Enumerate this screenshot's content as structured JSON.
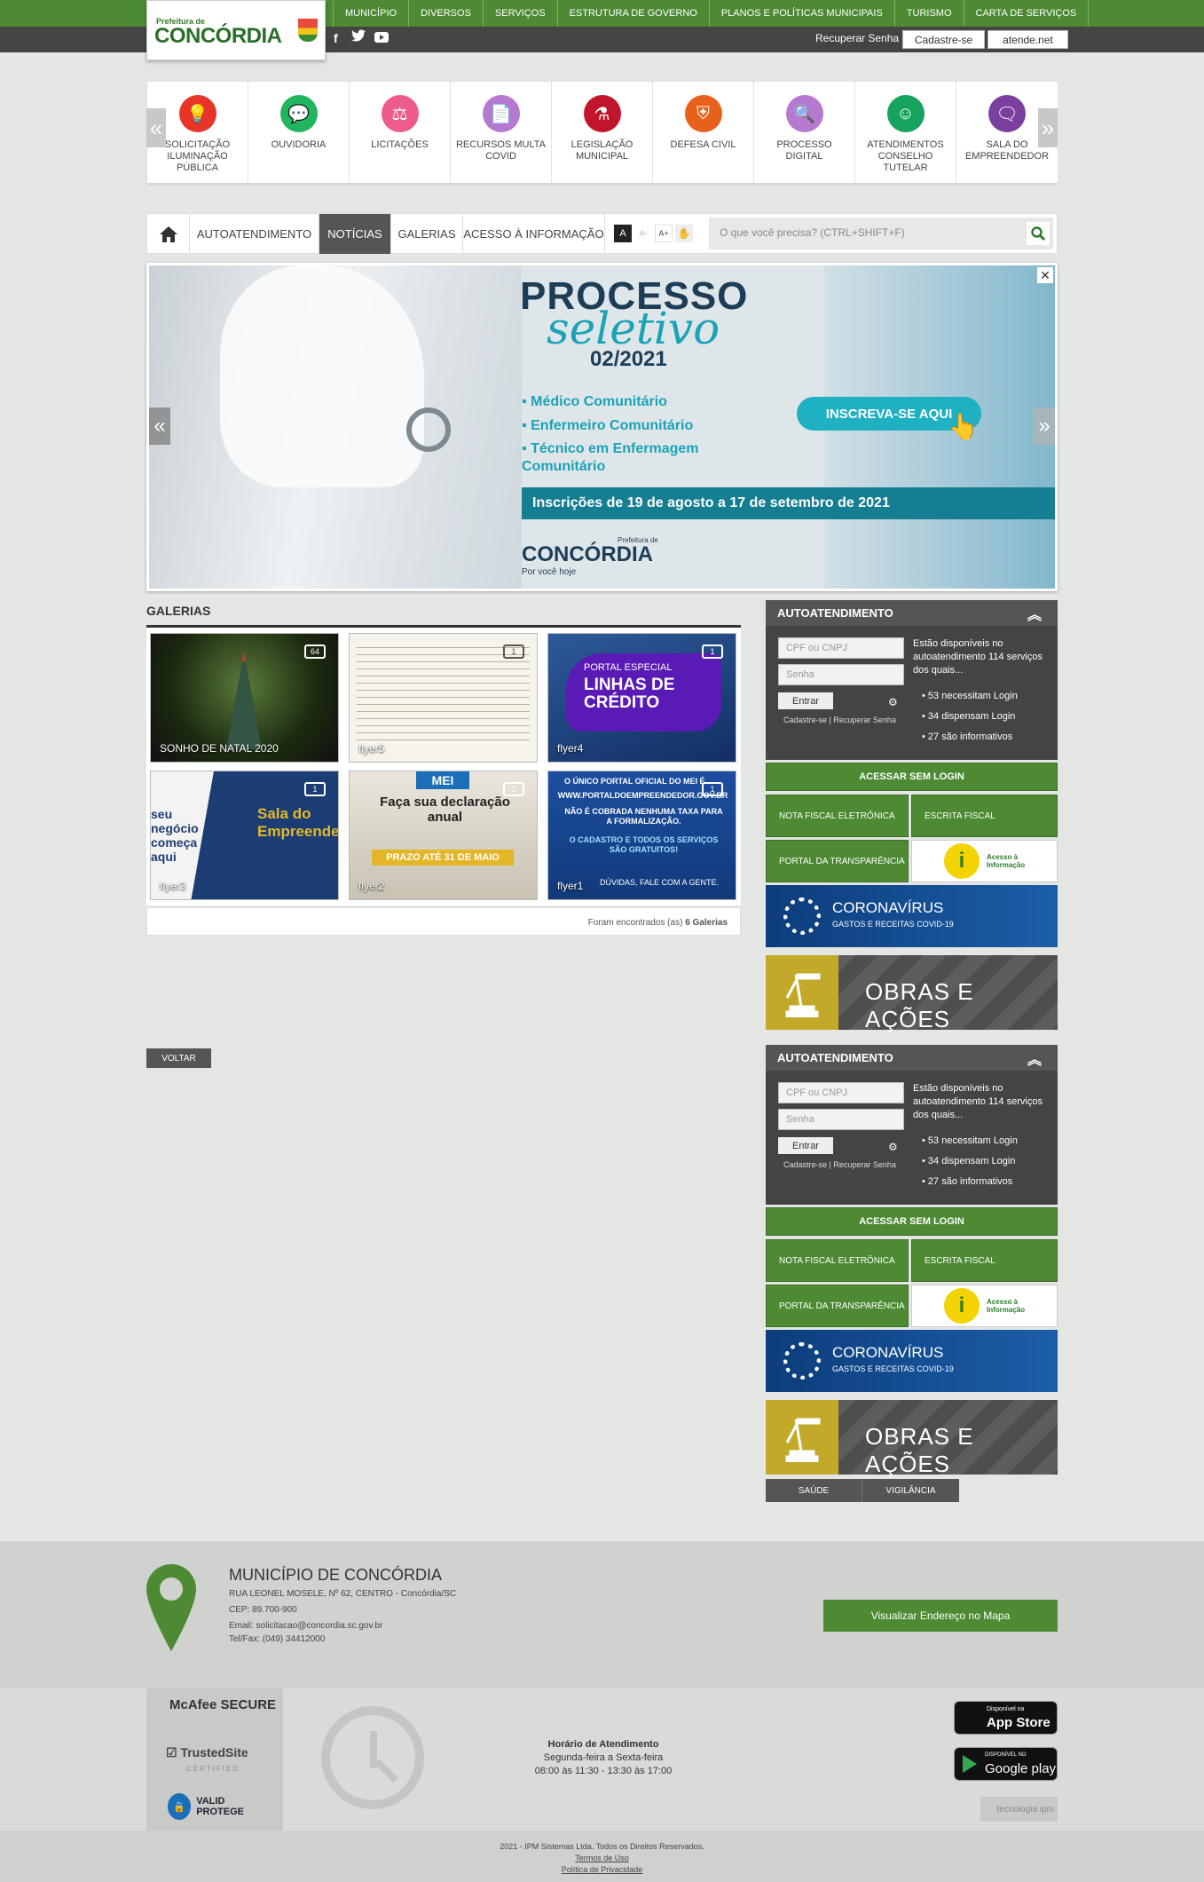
{
  "header": {
    "logo_small": "Prefeitura de",
    "logo_big": "CONCÓRDIA",
    "nav": [
      "MUNICÍPIO",
      "DIVERSOS",
      "SERVIÇOS",
      "ESTRUTURA DE GOVERNO",
      "PLANOS E POLÍTICAS MUNICIPAIS",
      "TURISMO",
      "CARTA DE SERVIÇOS"
    ],
    "recover": "Recuperar Senha",
    "signup": "Cadastre-se",
    "atende": "atende.net"
  },
  "carousel": {
    "items": [
      {
        "label": "SOLICITAÇÃO ILUMINAÇÃO PÚBLICA",
        "icon": "lightbulb-icon",
        "color": "#e8352a"
      },
      {
        "label": "OUVIDORIA",
        "icon": "chat-icon",
        "color": "#22b560"
      },
      {
        "label": "LICITAÇÕES",
        "icon": "auction-icon",
        "color": "#ee5c8c"
      },
      {
        "label": "RECURSOS MULTA COVID",
        "icon": "document-icon",
        "color": "#b57ad0"
      },
      {
        "label": "LEGISLAÇÃO MUNICIPAL",
        "icon": "scales-icon",
        "color": "#c0152a"
      },
      {
        "label": "DEFESA CIVIL",
        "icon": "shield-icon",
        "color": "#e8611a"
      },
      {
        "label": "PROCESSO DIGITAL",
        "icon": "magnifier-icon",
        "color": "#b57ad0"
      },
      {
        "label": "ATENDIMENTOS CONSELHO TUTELAR",
        "icon": "person-icon",
        "color": "#17a35f"
      },
      {
        "label": "SALA DO EMPREENDEDOR",
        "icon": "business-icon",
        "color": "#7b3fa0"
      }
    ]
  },
  "menu": {
    "items": [
      "AUTOATENDIMENTO",
      "NOTÍCIAS",
      "GALERIAS",
      "ACESSO À INFORMAÇÃO"
    ],
    "font_a": "A",
    "font_small": "A-",
    "font_big": "A+",
    "search_placeholder": "O que você precisa? (CTRL+SHIFT+F)"
  },
  "banner": {
    "title1": "PROCESSO",
    "title2": "seletivo",
    "number": "02/2021",
    "bullets": [
      "Médico Comunitário",
      "Enfermeiro Comunitário",
      "Técnico em Enfermagem Comunitário"
    ],
    "cta": "INSCREVA-SE AQUI",
    "dates": "Inscrições de 19 de agosto a 17 de setembro de 2021",
    "brand_small": "Prefeitura de",
    "brand": "CONCÓRDIA",
    "brand_slogan": "Por você hoje"
  },
  "galleries": {
    "title": "GALERIAS",
    "items": [
      {
        "name": "SONHO DE NATAL 2020",
        "count": "64"
      },
      {
        "name": "flyer5",
        "count": "1"
      },
      {
        "name": "flyer4",
        "count": "1"
      },
      {
        "name": "flyer3",
        "count": "1"
      },
      {
        "name": "flyer2",
        "count": "1"
      },
      {
        "name": "flyer1",
        "count": "1"
      }
    ],
    "flyer4_text1": "PORTAL ESPECIAL",
    "flyer4_text2": "LINHAS DE CRÉDITO",
    "flyer3_text1": "seu negócio começa aqui",
    "flyer3_text2": "Sala do Empreendedor",
    "flyer2_tag": "MEI",
    "flyer2_text": "Faça sua declaração anual",
    "flyer2_deadline": "PRAZO ATÉ 31 DE MAIO",
    "flyer1_text1": "O ÚNICO PORTAL OFICIAL DO MEI É",
    "flyer1_text2": "WWW.PORTALDOEMPREENDEDOR.GOV.BR",
    "flyer1_text3": "NÃO É COBRADA NENHUMA TAXA PARA A FORMALIZAÇÃO.",
    "flyer1_text4": "O CADASTRO E TODOS OS SERVIÇOS SÃO GRATUITOS!",
    "flyer1_text5": "DÚVIDAS, FALE COM A GENTE.",
    "found_prefix": "Foram encontrados (as)",
    "found_count": "6 Galerias",
    "back": "VOLTAR"
  },
  "sidebar": {
    "title": "AUTOATENDIMENTO",
    "cpf_placeholder": "CPF ou CNPJ",
    "pwd_placeholder": "Senha",
    "enter": "Entrar",
    "signup": "Cadastre-se",
    "recover": "Recuperar Senha",
    "info": "Estão disponíveis no autoatendimento 114 serviços dos quais...",
    "stats": [
      "53 necessitam Login",
      "34 dispensam Login",
      "27 são informativos"
    ],
    "no_login": "ACESSAR SEM LOGIN",
    "nf": "NOTA FISCAL ELETRÔNICA",
    "escrita": "ESCRITA FISCAL",
    "transp": "PORTAL DA TRANSPARÊNCIA",
    "acesso": "Acesso à Informação",
    "covid_title": "CORONAVÍRUS",
    "covid_sub": "GASTOS E RECEITAS COVID-19",
    "obras": "OBRAS E AÇÕES",
    "tab_saude": "SAÚDE",
    "tab_vig": "VIGILÂNCIA"
  },
  "footer": {
    "name": "MUNICÍPIO DE CONCÓRDIA",
    "address": "RUA LEONEL MOSELE, Nº 62, CENTRO - Concórdia/SC",
    "cep": "CEP: 89.700-900",
    "email": "Email: solicitacao@concordia.sc.gov.br",
    "tel": "Tel/Fax: (049) 34412000",
    "map_btn": "Visualizar Endereço no Mapa",
    "mcafee": "McAfee SECURE",
    "trusted": "TrustedSite",
    "certified": "CERTIFIED",
    "valid": "VALID PROTEGE",
    "hours_title": "Horário de Atendimento",
    "hours_days": "Segunda-feira a Sexta-feira",
    "hours_time": "08:00 às 11:30 - 13:30 às 17:00",
    "appstore_small": "Disponível na",
    "appstore": "App Store",
    "gplay_small": "DISPONÍVEL NO",
    "gplay": "Google play",
    "ipm": "tecnologia ipm",
    "copyright": "2021 - IPM Sistemas Ltda. Todos os Direitos Reservados.",
    "terms": "Termos de Uso",
    "privacy": "Política de Privacidade"
  }
}
